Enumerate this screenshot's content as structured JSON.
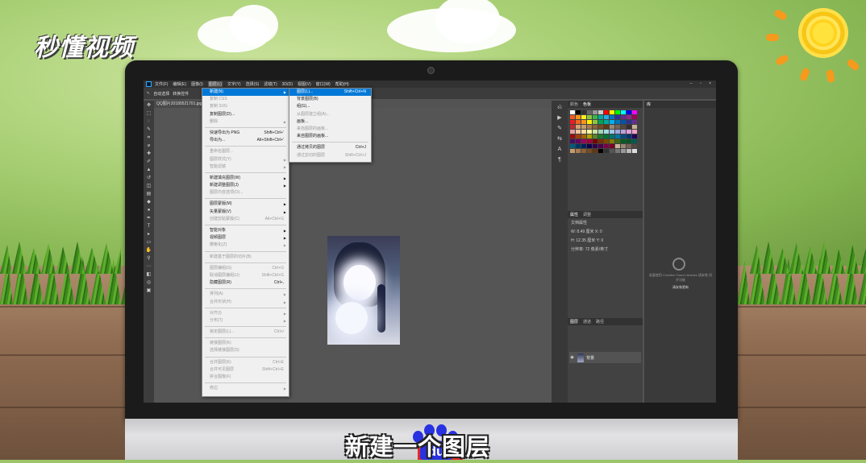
{
  "watermark": {
    "brand": "秒懂视频"
  },
  "caption": {
    "text": "新建一个图层"
  },
  "baidu": {
    "mark": "du"
  },
  "ps": {
    "menu": [
      "文件(F)",
      "编辑(E)",
      "图像(I)",
      "图层(L)",
      "文字(Y)",
      "选择(S)",
      "滤镜(T)",
      "3D(D)",
      "视图(V)",
      "窗口(W)",
      "帮助(H)"
    ],
    "active_menu_index": 3,
    "options": [
      "自动选择",
      "转换控件"
    ],
    "doc_tab": "QQ图片20180521701.jpg",
    "layer_menu": [
      {
        "label": "新建(N)",
        "arrow": true,
        "hl": true
      },
      {
        "label": "复制 CSS",
        "disabled": true
      },
      {
        "label": "复制 SVG",
        "disabled": true
      },
      {
        "label": "复制图层(D)..."
      },
      {
        "label": "删除",
        "arrow": true,
        "disabled": true
      },
      {
        "sep": true
      },
      {
        "label": "快速导出为 PNG",
        "shortcut": "Shift+Ctrl+'"
      },
      {
        "label": "导出为...",
        "shortcut": "Alt+Shift+Ctrl+'"
      },
      {
        "sep": true
      },
      {
        "label": "重命名图层...",
        "disabled": true
      },
      {
        "label": "图层样式(Y)",
        "arrow": true,
        "disabled": true
      },
      {
        "label": "智能滤镜",
        "arrow": true,
        "disabled": true
      },
      {
        "sep": true
      },
      {
        "label": "新建填充图层(W)",
        "arrow": true
      },
      {
        "label": "新建调整图层(J)",
        "arrow": true
      },
      {
        "label": "图层内容选项(O)...",
        "disabled": true
      },
      {
        "sep": true
      },
      {
        "label": "图层蒙版(M)",
        "arrow": true
      },
      {
        "label": "矢量蒙版(V)",
        "arrow": true
      },
      {
        "label": "创建剪贴蒙版(C)",
        "shortcut": "Alt+Ctrl+G",
        "disabled": true
      },
      {
        "sep": true
      },
      {
        "label": "智能对象",
        "arrow": true
      },
      {
        "label": "视频图层",
        "arrow": true
      },
      {
        "label": "栅格化(Z)",
        "arrow": true,
        "disabled": true
      },
      {
        "sep": true
      },
      {
        "label": "新建基于图层的切片(B)",
        "disabled": true
      },
      {
        "sep": true
      },
      {
        "label": "图层编组(G)",
        "shortcut": "Ctrl+G",
        "disabled": true
      },
      {
        "label": "取消图层编组(U)",
        "shortcut": "Shift+Ctrl+G",
        "disabled": true
      },
      {
        "label": "隐藏图层(R)",
        "shortcut": "Ctrl+,"
      },
      {
        "sep": true
      },
      {
        "label": "排列(A)",
        "arrow": true,
        "disabled": true
      },
      {
        "label": "合并形状(H)",
        "arrow": true,
        "disabled": true
      },
      {
        "sep": true
      },
      {
        "label": "对齐(I)",
        "arrow": true,
        "disabled": true
      },
      {
        "label": "分布(T)",
        "arrow": true,
        "disabled": true
      },
      {
        "sep": true
      },
      {
        "label": "锁定图层(L)...",
        "shortcut": "Ctrl+/",
        "disabled": true
      },
      {
        "sep": true
      },
      {
        "label": "链接图层(K)",
        "disabled": true
      },
      {
        "label": "选择链接图层(S)",
        "disabled": true
      },
      {
        "sep": true
      },
      {
        "label": "合并图层(E)",
        "shortcut": "Ctrl+E",
        "disabled": true
      },
      {
        "label": "合并可见图层",
        "shortcut": "Shift+Ctrl+E",
        "disabled": true
      },
      {
        "label": "拼合图像(F)",
        "disabled": true
      },
      {
        "sep": true
      },
      {
        "label": "修边",
        "arrow": true,
        "disabled": true
      }
    ],
    "new_submenu": [
      {
        "label": "图层(L)...",
        "shortcut": "Shift+Ctrl+N",
        "hl": true
      },
      {
        "label": "背景图层(B)"
      },
      {
        "label": "组(G)..."
      },
      {
        "label": "从图层建立组(A)...",
        "disabled": true
      },
      {
        "label": "画板..."
      },
      {
        "label": "来自图层的画板...",
        "disabled": true
      },
      {
        "label": "来自图层的画板..."
      },
      {
        "sep": true
      },
      {
        "label": "通过拷贝的图层",
        "shortcut": "Ctrl+J"
      },
      {
        "label": "通过剪切的图层",
        "shortcut": "Shift+Ctrl+J",
        "disabled": true
      }
    ],
    "panels": {
      "swatch_tabs": [
        "颜色",
        "色板"
      ],
      "props_tabs": [
        "属性",
        "调整"
      ],
      "props_title": "文档属性",
      "props_rows": [
        "W: 8.49 厘米   X: 0",
        "H: 12.35 厘米  Y: 0",
        "分辨率: 72 像素/英寸"
      ],
      "layers_tabs": [
        "图层",
        "通道",
        "路径"
      ],
      "layer_name": "背景",
      "libraries_tab": "库",
      "cc_text": "若要使用 Creative Cloud Libraries 请安装 同步功能",
      "cc_link": "请安装更新"
    }
  }
}
